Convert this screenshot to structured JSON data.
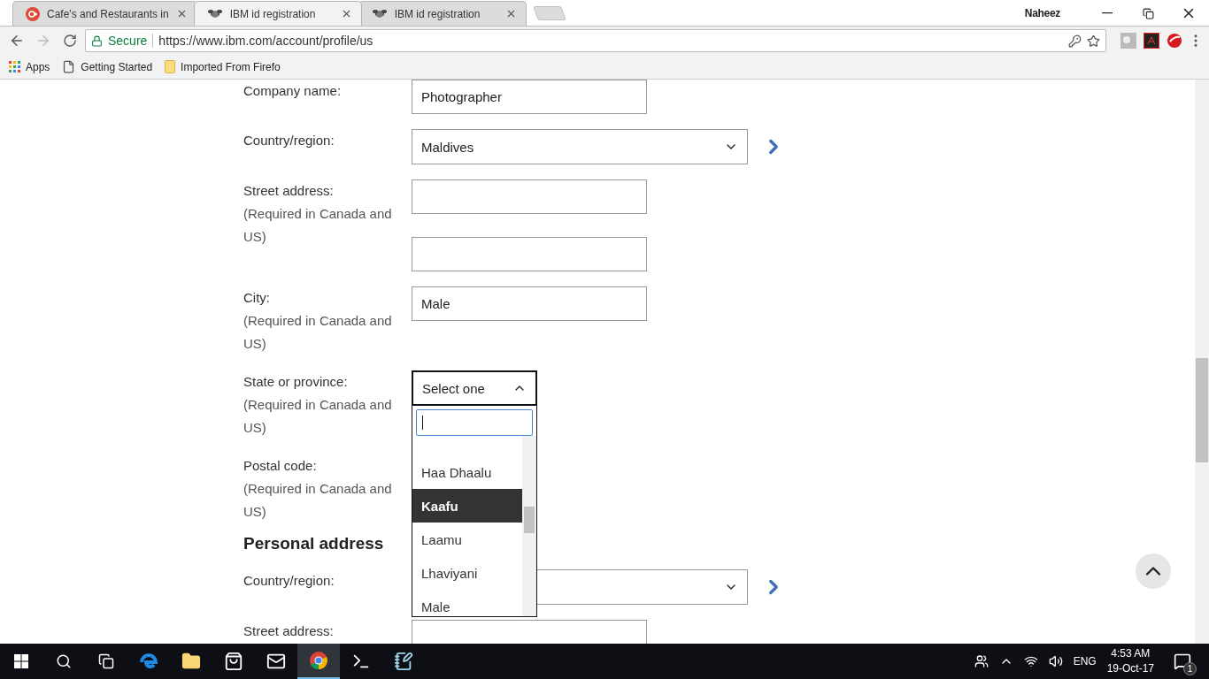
{
  "browser": {
    "tabs": [
      {
        "title": "Cafe's and Restaurants in",
        "selected": false,
        "kind": "gplus"
      },
      {
        "title": "IBM id registration",
        "selected": true,
        "kind": "ibm"
      },
      {
        "title": "IBM id registration",
        "selected": false,
        "kind": "ibm"
      }
    ],
    "profile": "Naheez",
    "security": "Secure",
    "url": "https://www.ibm.com/account/profile/us",
    "bookmarks": [
      {
        "label": "Apps",
        "kind": "apps"
      },
      {
        "label": "Getting Started",
        "kind": "page"
      },
      {
        "label": "Imported From Firefo",
        "kind": "folder"
      }
    ]
  },
  "form": [
    {
      "kind": "text",
      "label": "Company name:",
      "fields": [
        {
          "kind": "filled",
          "value": "Photographer"
        }
      ]
    },
    {
      "kind": "select",
      "label": "Country/region:",
      "value": "Maldives",
      "open": false
    },
    {
      "kind": "text",
      "label": "Street address:",
      "note": "(Required in Canada and US)",
      "fields": [
        {
          "kind": "blank"
        },
        {
          "kind": "blank"
        }
      ]
    },
    {
      "kind": "text",
      "label": "City:",
      "note": "(Required in Canada and US)",
      "fields": [
        {
          "kind": "filled",
          "value": "Male"
        }
      ]
    },
    {
      "kind": "select",
      "label": "State or province:",
      "note": "(Required in Canada and US)",
      "placeholder": "Select one",
      "open": true,
      "options": [
        {
          "label": "Haa Dhaalu",
          "selected": false
        },
        {
          "label": "Kaafu",
          "selected": true
        },
        {
          "label": "Laamu",
          "selected": false
        },
        {
          "label": "Lhaviyani",
          "selected": false
        },
        {
          "label": "Male",
          "selected": false
        }
      ]
    },
    {
      "kind": "label",
      "label": "Postal code:",
      "note": "(Required in Canada and US)"
    },
    {
      "kind": "heading",
      "label": "Personal address"
    },
    {
      "kind": "select",
      "label": "Country/region:",
      "open": false
    },
    {
      "kind": "text",
      "label": "Street address:",
      "fields": [
        {
          "kind": "blank"
        }
      ]
    }
  ],
  "taskbar": {
    "language": "ENG",
    "time": "4:53 AM",
    "date": "19-Oct-17",
    "notifications": "1"
  }
}
